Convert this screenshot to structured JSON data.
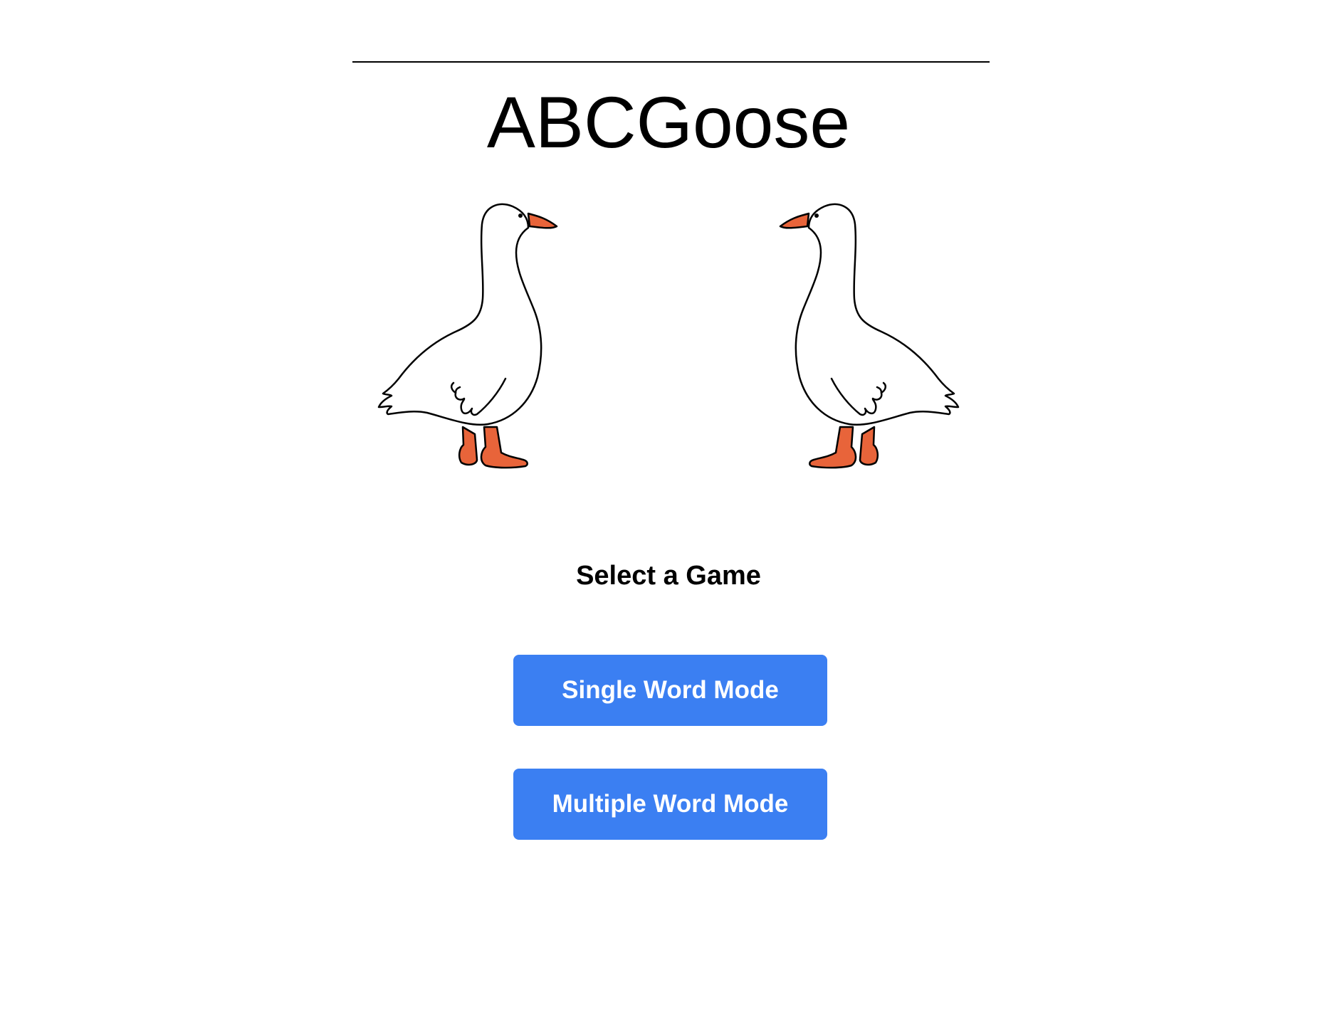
{
  "app": {
    "title": "ABCGoose"
  },
  "illustration": {
    "left_goose_icon": "goose-icon",
    "right_goose_icon": "goose-icon",
    "goose_body_color": "#ffffff",
    "goose_outline_color": "#000000",
    "goose_beak_leg_color": "#e8643a"
  },
  "menu": {
    "heading": "Select a Game",
    "buttons": [
      {
        "label": "Single Word Mode"
      },
      {
        "label": "Multiple Word Mode"
      }
    ],
    "button_color": "#3b7ff2",
    "button_text_color": "#ffffff"
  }
}
